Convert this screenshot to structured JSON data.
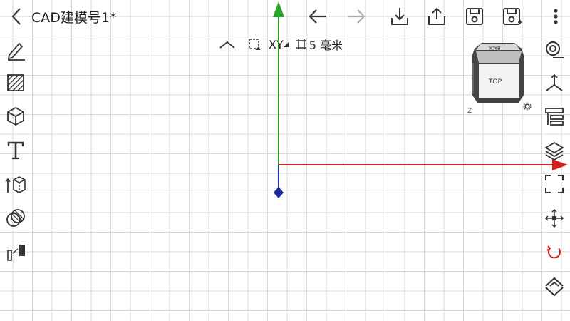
{
  "header": {
    "title": "CAD建模号1*"
  },
  "view_bar": {
    "plane": "XY",
    "grid_size": "5 毫米"
  },
  "viewcube": {
    "top_label": "TOP",
    "back_label": "BACK",
    "z_label": "Z"
  },
  "colors": {
    "x_axis": "#d02020",
    "y_axis": "#2aa52a",
    "z_axis": "#1a2a9a",
    "rotate_accent": "#d02020"
  },
  "toolbar_top": [
    "back-arrow-icon",
    "undo-icon",
    "redo-icon",
    "download-icon",
    "share-icon",
    "save-icon",
    "save-as-icon",
    "more-icon"
  ],
  "toolbar_left": [
    "sketch-pencil-icon",
    "hatch-icon",
    "cube-icon",
    "text-icon",
    "extrude-icon",
    "boolean-icon",
    "dimension-icon"
  ],
  "toolbar_right": [
    "snap-icon",
    "axes-icon",
    "tree-icon",
    "layers-icon",
    "fit-view-icon",
    "move-icon",
    "rotate-icon",
    "collapse-icon"
  ]
}
